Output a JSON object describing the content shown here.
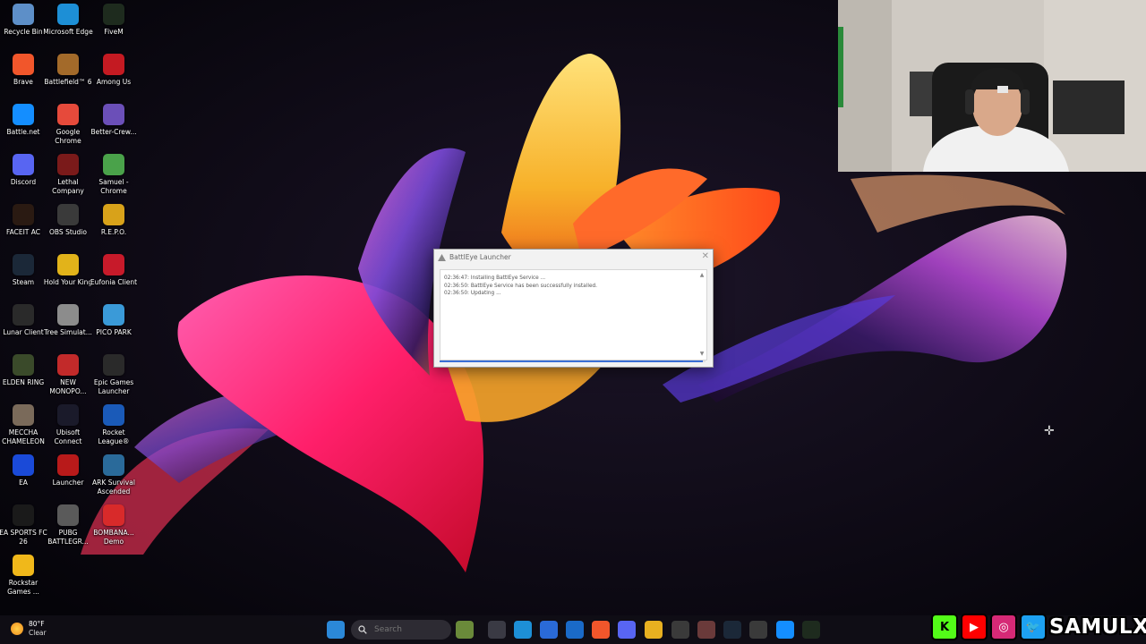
{
  "desktop": {
    "icons": [
      {
        "label": "Recycle Bin",
        "icon": "recycle-bin-icon",
        "color": "#5d8fc8"
      },
      {
        "label": "Microsoft Edge",
        "icon": "edge-icon",
        "color": "#1d8fd6"
      },
      {
        "label": "FiveM",
        "icon": "fivem-icon",
        "color": "#1e2b1e"
      },
      {
        "label": "Brave",
        "icon": "brave-icon",
        "color": "#f1562b"
      },
      {
        "label": "Battlefield™ 6",
        "icon": "battlefield-icon",
        "color": "#a36a2a"
      },
      {
        "label": "Among Us",
        "icon": "among-us-icon",
        "color": "#c41a22"
      },
      {
        "label": "Battle.net",
        "icon": "battlenet-icon",
        "color": "#148eff"
      },
      {
        "label": "Google Chrome",
        "icon": "chrome-icon",
        "color": "#e64a3b"
      },
      {
        "label": "Better-Crew...",
        "icon": "better-crewlink-icon",
        "color": "#6b4fb8"
      },
      {
        "label": "Discord",
        "icon": "discord-icon",
        "color": "#5865f2"
      },
      {
        "label": "Lethal Company",
        "icon": "lethal-company-icon",
        "color": "#7a1a1a"
      },
      {
        "label": "Samuel - Chrome",
        "icon": "chrome-profile-icon",
        "color": "#4aa24a"
      },
      {
        "label": "FACEIT AC",
        "icon": "faceit-icon",
        "color": "#2a1a12"
      },
      {
        "label": "OBS Studio",
        "icon": "obs-icon",
        "color": "#3a3a3a"
      },
      {
        "label": "R.E.P.O.",
        "icon": "repo-icon",
        "color": "#d8a21a"
      },
      {
        "label": "Steam",
        "icon": "steam-icon",
        "color": "#1b2838"
      },
      {
        "label": "Hold Your King",
        "icon": "hold-your-king-icon",
        "color": "#e2b31a"
      },
      {
        "label": "Eufonia Client",
        "icon": "eufonia-icon",
        "color": "#c71a2a"
      },
      {
        "label": "Lunar Client",
        "icon": "lunar-client-icon",
        "color": "#2a2a2a"
      },
      {
        "label": "Tree Simulat...",
        "icon": "tree-simulator-icon",
        "color": "#8c8c8c"
      },
      {
        "label": "PICO PARK",
        "icon": "pico-park-icon",
        "color": "#3a9ad8"
      },
      {
        "label": "ELDEN RING",
        "icon": "elden-ring-icon",
        "color": "#3a4a2a"
      },
      {
        "label": "NEW MONOPO...",
        "icon": "monopoly-icon",
        "color": "#c22a2a"
      },
      {
        "label": "Epic Games Launcher",
        "icon": "epic-games-icon",
        "color": "#2a2a2a"
      },
      {
        "label": "MECCHA CHAMELEON",
        "icon": "meccha-chameleon-icon",
        "color": "#7a6a5a"
      },
      {
        "label": "Ubisoft Connect",
        "icon": "ubisoft-icon",
        "color": "#1a1a2a"
      },
      {
        "label": "Rocket League®",
        "icon": "rocket-league-icon",
        "color": "#1a5ab8"
      },
      {
        "label": "EA",
        "icon": "ea-icon",
        "color": "#1a4ad8"
      },
      {
        "label": "Launcher",
        "icon": "launcher-icon",
        "color": "#b81a1a"
      },
      {
        "label": "ARK Survival Ascended",
        "icon": "ark-icon",
        "color": "#2a6a9a"
      },
      {
        "label": "EA SPORTS FC 26",
        "icon": "ea-sports-fc-icon",
        "color": "#1a1a1a"
      },
      {
        "label": "PUBG BATTLEGR...",
        "icon": "pubg-icon",
        "color": "#5a5a5a"
      },
      {
        "label": "BOMBANA... Demo",
        "icon": "bombana-icon",
        "color": "#d82a2a"
      },
      {
        "label": "Rockstar Games ...",
        "icon": "rockstar-icon",
        "color": "#f0b81a"
      }
    ]
  },
  "dialog": {
    "title": "BattlEye Launcher",
    "close_glyph": "✕",
    "log": [
      "02:36:47: Installing BattlEye Service ...",
      "02:36:50: BattlEye Service has been successfully installed.",
      "02:36:50: Updating ..."
    ],
    "progress": 0.99
  },
  "taskbar": {
    "weather_temp": "80°F",
    "weather_cond": "Clear",
    "search_placeholder": "Search",
    "pinned": [
      {
        "name": "windows-start-icon",
        "color": "#2b88d8"
      },
      {
        "name": "widget-game-icon",
        "color": "#6a8a3a"
      },
      {
        "name": "task-view-icon",
        "color": "#3a3a44"
      },
      {
        "name": "edge-icon",
        "color": "#1d8fd6"
      },
      {
        "name": "store-icon",
        "color": "#2a6ad8"
      },
      {
        "name": "outlook-icon",
        "color": "#1a6ac8"
      },
      {
        "name": "brave-icon",
        "color": "#f1562b"
      },
      {
        "name": "discord-icon",
        "color": "#5865f2"
      },
      {
        "name": "file-explorer-icon",
        "color": "#e8b020"
      },
      {
        "name": "chrome-icon",
        "color": "#3a3a3a"
      },
      {
        "name": "app-icon",
        "color": "#6a3a3a"
      },
      {
        "name": "steam-icon",
        "color": "#1b2838"
      },
      {
        "name": "media-player-icon",
        "color": "#3a3a3a"
      },
      {
        "name": "battlenet-icon",
        "color": "#148eff"
      },
      {
        "name": "fivem-icon",
        "color": "#1e2b1e"
      }
    ]
  },
  "overlay": {
    "handle": "SAMULX",
    "socials": [
      {
        "name": "kick-icon",
        "glyph": "K",
        "color": "#53fc18",
        "fg": "#000"
      },
      {
        "name": "youtube-icon",
        "glyph": "▶",
        "color": "#ff0000",
        "fg": "#fff"
      },
      {
        "name": "instagram-icon",
        "glyph": "◎",
        "color": "#d62976",
        "fg": "#fff"
      },
      {
        "name": "twitter-icon",
        "glyph": "🐦",
        "color": "#1da1f2",
        "fg": "#fff"
      }
    ]
  }
}
